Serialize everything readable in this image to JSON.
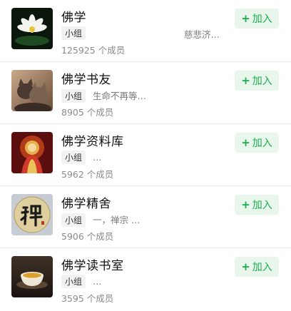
{
  "groups": [
    {
      "name": "佛学",
      "tag": "小组",
      "desc": "慈悲济…",
      "members": "125925 个成员",
      "join": "加入",
      "icon": "lotus-thumbnail"
    },
    {
      "name": "佛学书友",
      "tag": "小组",
      "desc": "生命不再等…",
      "members": "8905 个成员",
      "join": "加入",
      "icon": "cats-thumbnail"
    },
    {
      "name": "佛学资料库",
      "tag": "小组",
      "desc": "…",
      "members": "5962 个成员",
      "join": "加入",
      "icon": "buddha-thumbnail"
    },
    {
      "name": "佛学精舍",
      "tag": "小组",
      "desc": "一，禅宗 …",
      "members": "5906 个成员",
      "join": "加入",
      "icon": "zen-calligraphy-thumbnail"
    },
    {
      "name": "佛学读书室",
      "tag": "小组",
      "desc": "…",
      "members": "3595 个成员",
      "join": "加入",
      "icon": "tea-cup-thumbnail"
    }
  ],
  "colors": {
    "join_text": "#1aad4f",
    "join_bg": "#e8f6ec"
  }
}
